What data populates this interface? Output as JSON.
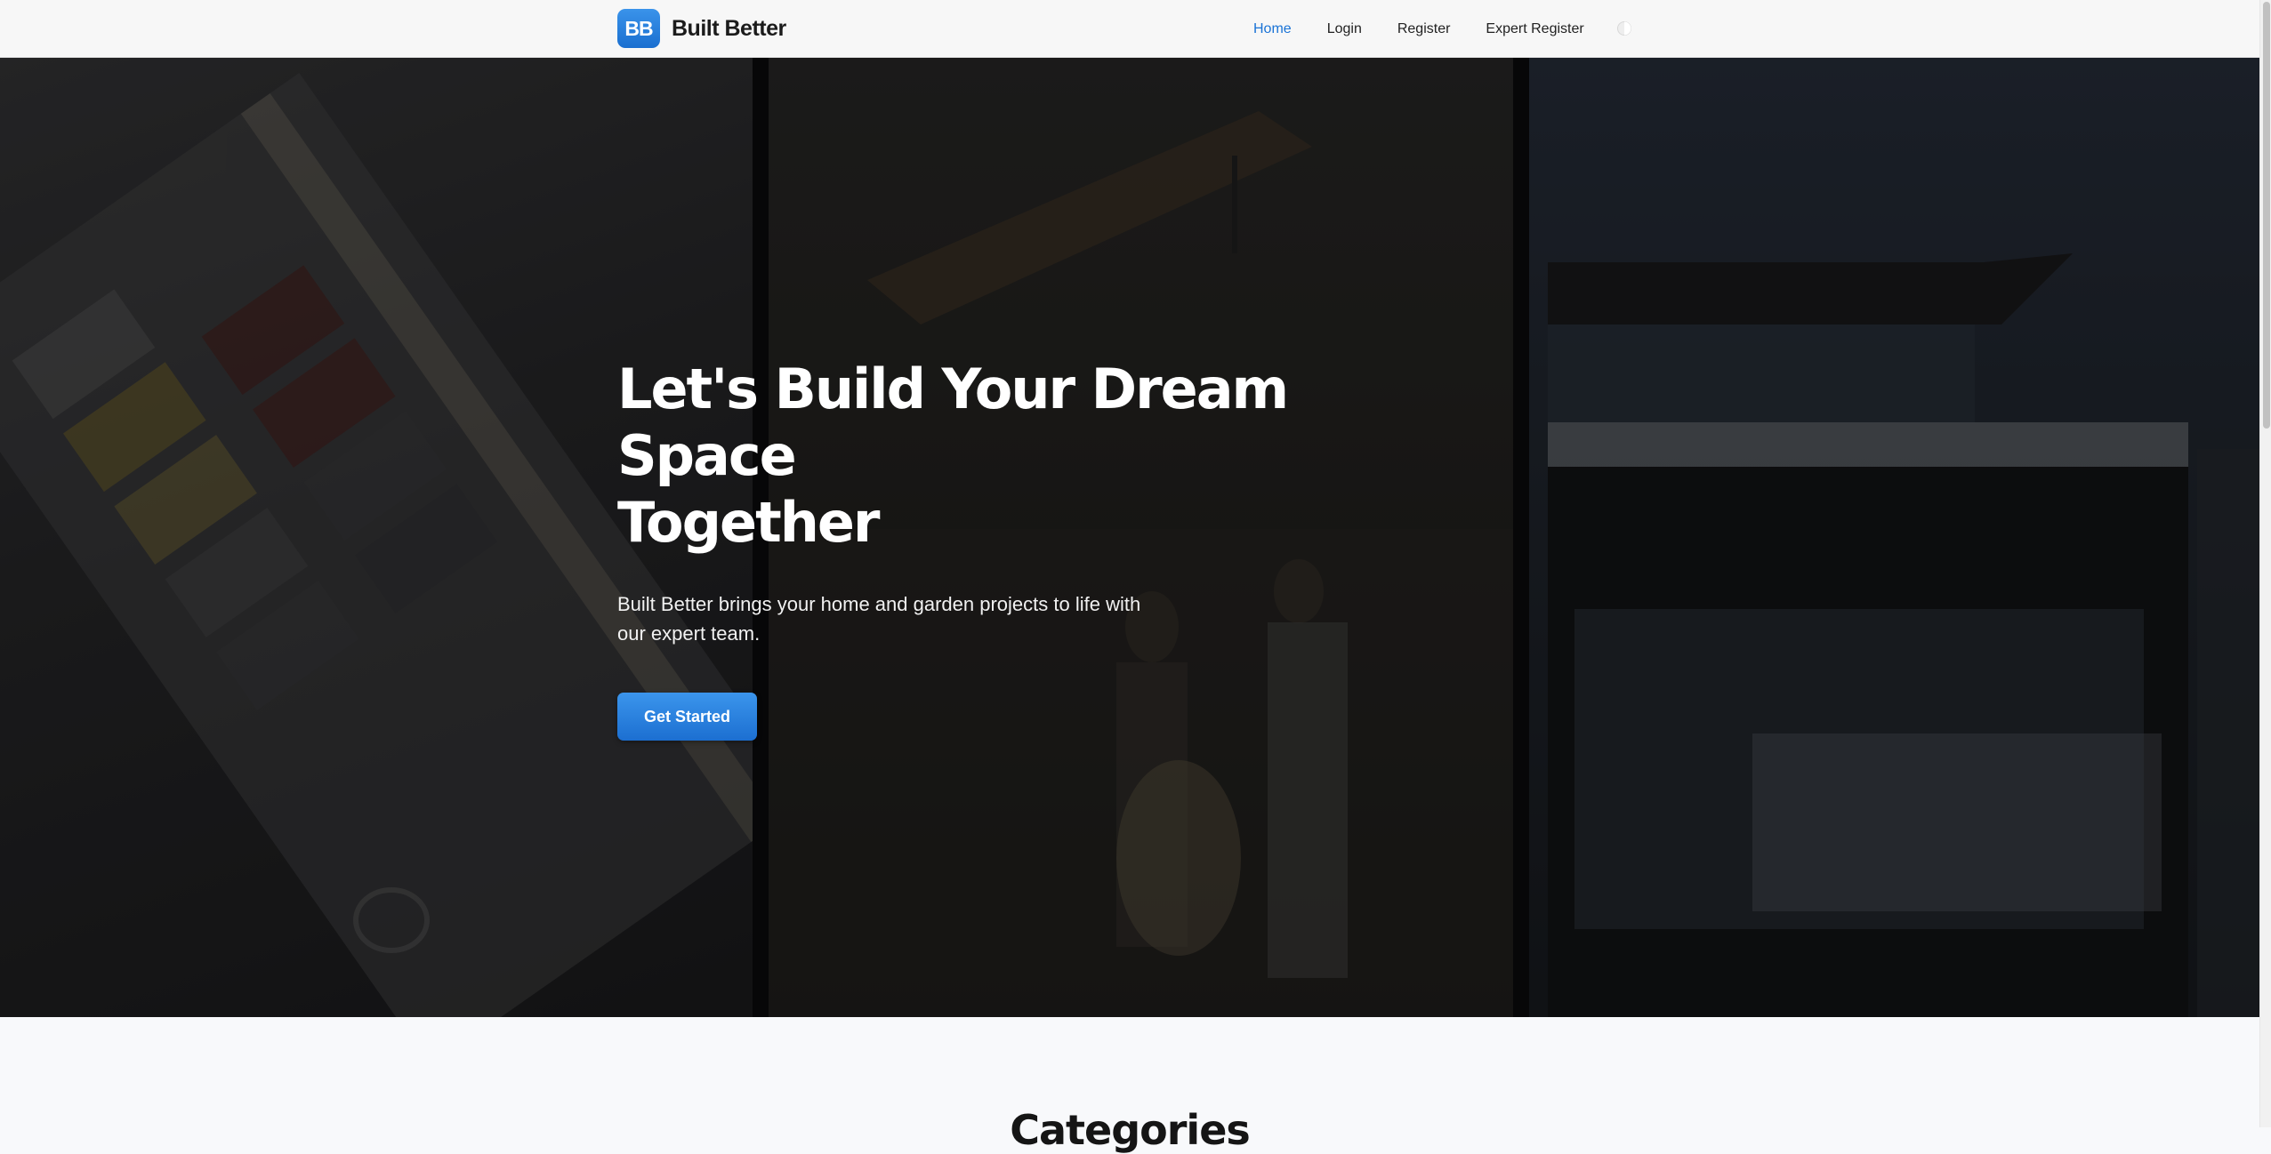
{
  "brand": {
    "logo_text": "BB",
    "name": "Built Better"
  },
  "nav": {
    "items": [
      {
        "label": "Home",
        "active": true
      },
      {
        "label": "Login",
        "active": false
      },
      {
        "label": "Register",
        "active": false
      },
      {
        "label": "Expert Register",
        "active": false
      }
    ],
    "theme_toggle_icon": "half-moon-icon"
  },
  "hero": {
    "title_line1": "Let's Build Your Dream Space",
    "title_line2": "Together",
    "subtitle": "Built Better brings your home and garden projects to life with our expert team.",
    "cta_label": "Get Started"
  },
  "categories": {
    "title": "Categories"
  },
  "colors": {
    "accent": "#1a73d6",
    "navbar_bg": "#f7f7f7",
    "hero_text": "#ffffff"
  }
}
